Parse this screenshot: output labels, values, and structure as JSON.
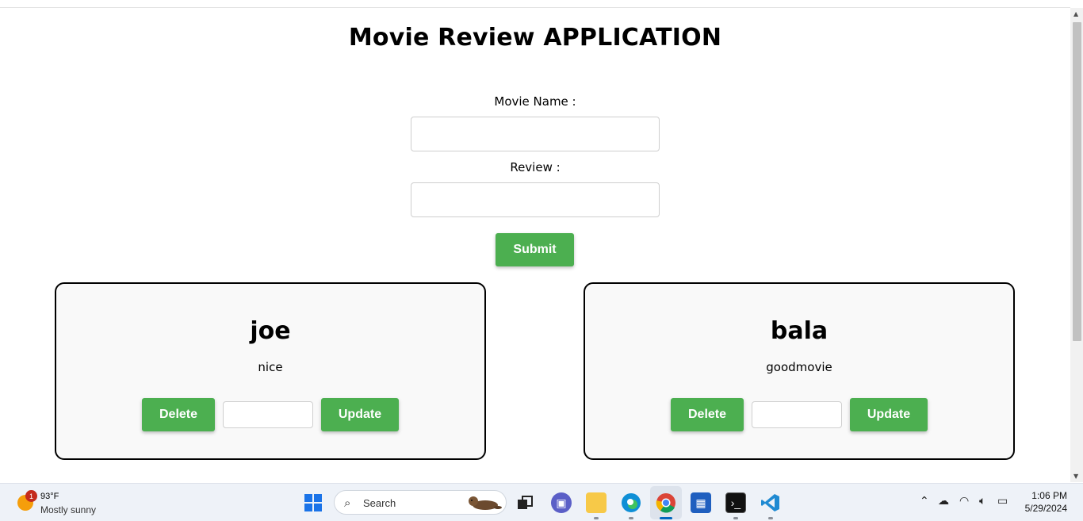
{
  "page": {
    "title": "Movie Review APPLICATION",
    "form": {
      "movie_name_label": "Movie Name :",
      "movie_name_value": "",
      "review_label": "Review :",
      "review_value": "",
      "submit_label": "Submit"
    },
    "reviews": [
      {
        "name": "joe",
        "review": "nice",
        "delete_label": "Delete",
        "update_value": "",
        "update_label": "Update"
      },
      {
        "name": "bala",
        "review": "goodmovie",
        "delete_label": "Delete",
        "update_value": "",
        "update_label": "Update"
      }
    ],
    "accent_color": "#4caf50"
  },
  "taskbar": {
    "weather": {
      "badge": "1",
      "temperature": "93°F",
      "condition": "Mostly sunny"
    },
    "search_label": "Search",
    "apps": [
      "task-view",
      "teams-chat",
      "file-explorer",
      "edge",
      "chrome",
      "microsoft-store",
      "terminal",
      "vscode"
    ],
    "active_app": "chrome",
    "clock": {
      "time": "1:06 PM",
      "date": "5/29/2024"
    }
  }
}
